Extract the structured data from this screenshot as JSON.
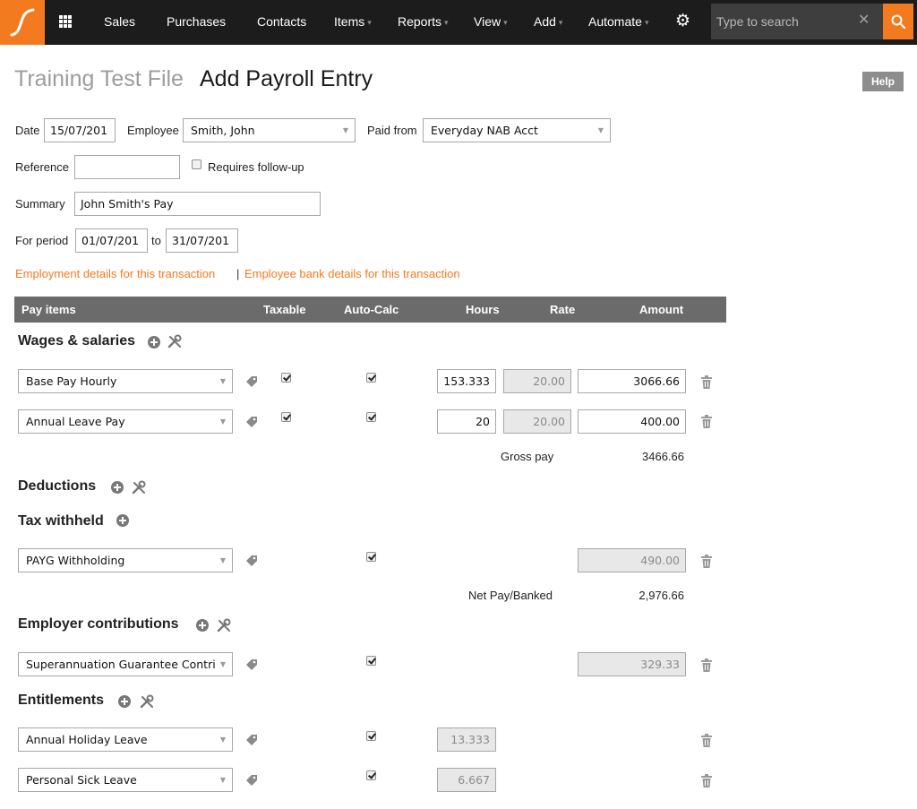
{
  "nav": {
    "logo_icon": "myob-logo",
    "apps_icon": "grid-icon",
    "items": [
      {
        "label": "Sales",
        "has_caret": false
      },
      {
        "label": "Purchases",
        "has_caret": false
      },
      {
        "label": "Contacts",
        "has_caret": false
      },
      {
        "label": "Items",
        "has_caret": true
      },
      {
        "label": "Reports",
        "has_caret": true
      },
      {
        "label": "View",
        "has_caret": true
      },
      {
        "label": "Add",
        "has_caret": true
      },
      {
        "label": "Automate",
        "has_caret": true
      }
    ],
    "caret_glyph": "▾",
    "settings_icon": "gear-icon",
    "search_placeholder": "Type to search",
    "clear_glyph": "✕"
  },
  "title": {
    "file": "Training Test File",
    "page": "Add Payroll Entry",
    "help": "Help"
  },
  "form": {
    "date_label": "Date",
    "date_value": "15/07/201",
    "employee_label": "Employee",
    "employee_value": "Smith, John",
    "paid_from_label": "Paid from",
    "paid_from_value": "Everyday NAB Acct",
    "reference_label": "Reference",
    "reference_value": "",
    "followup_label": "Requires follow-up",
    "followup_checked": false,
    "summary_label": "Summary",
    "summary_value": "John Smith's Pay",
    "period_label": "For period",
    "period_from": "01/07/201",
    "period_to_label": "to",
    "period_to": "31/07/201"
  },
  "links": {
    "employment": "Employment details for this transaction",
    "separator": "|",
    "bank": "Employee bank details for this transaction"
  },
  "table": {
    "headers": {
      "pay_items": "Pay items",
      "taxable": "Taxable",
      "auto_calc": "Auto-Calc",
      "hours": "Hours",
      "rate": "Rate",
      "amount": "Amount"
    }
  },
  "sections": {
    "wages": {
      "title": "Wages & salaries",
      "rows": [
        {
          "item": "Base Pay Hourly",
          "taxable": true,
          "auto_calc": true,
          "hours": "153.333",
          "rate": "20.00",
          "amount": "3066.66"
        },
        {
          "item": "Annual Leave Pay",
          "taxable": true,
          "auto_calc": true,
          "hours": "20",
          "rate": "20.00",
          "amount": "400.00"
        }
      ],
      "total_label": "Gross pay",
      "total_value": "3466.66"
    },
    "deductions": {
      "title": "Deductions"
    },
    "tax": {
      "title": "Tax withheld",
      "rows": [
        {
          "item": "PAYG Withholding",
          "auto_calc": true,
          "amount": "490.00"
        }
      ],
      "total_label": "Net Pay/Banked",
      "total_value": "2,976.66"
    },
    "employer": {
      "title": "Employer contributions",
      "rows": [
        {
          "item": "Superannuation Guarantee Contri",
          "auto_calc": true,
          "amount": "329.33"
        }
      ]
    },
    "entitlements": {
      "title": "Entitlements",
      "rows": [
        {
          "item": "Annual Holiday Leave",
          "auto_calc": true,
          "hours": "13.333"
        },
        {
          "item": "Personal Sick Leave",
          "auto_calc": true,
          "hours": "6.667"
        }
      ]
    }
  },
  "colors": {
    "accent": "#f47a20",
    "nav_bg": "#1c1c1c",
    "header_bg": "#6b6b6b"
  }
}
